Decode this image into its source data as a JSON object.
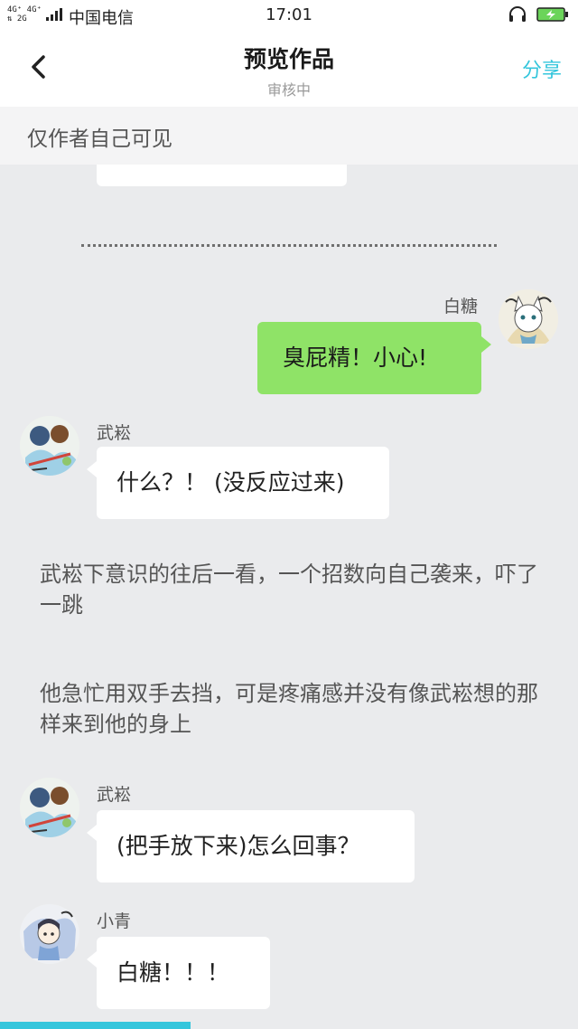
{
  "status_bar": {
    "network": "4G⁺ 4G⁺",
    "network_2": "⇅ 2G",
    "carrier": "中国电信",
    "time": "17:01",
    "icons": [
      "signal-bars-icon",
      "headset-icon",
      "battery-charging-icon"
    ]
  },
  "nav": {
    "back_icon": "chevron-left-icon",
    "title": "预览作品",
    "subtitle": "审核中",
    "share_label": "分享"
  },
  "notice": {
    "text": "仅作者自己可见"
  },
  "messages": [
    {
      "speaker": "白糖",
      "side": "right",
      "text": "臭屁精！小心!"
    },
    {
      "speaker": "武崧",
      "side": "left",
      "text": "什么？！ (没反应过来)"
    },
    {
      "type": "narration",
      "text": "武崧下意识的往后一看，一个招数向自己袭来，吓了一跳"
    },
    {
      "type": "narration",
      "text": "他急忙用双手去挡，可是疼痛感并没有像武崧想的那样来到他的身上"
    },
    {
      "speaker": "武崧",
      "side": "left",
      "text": "(把手放下来)怎么回事？"
    },
    {
      "speaker": "小青",
      "side": "left",
      "text": "白糖！！！"
    }
  ],
  "reading_progress": 0.33,
  "colors": {
    "accent": "#35c6dc",
    "right_bubble": "#8fe367",
    "left_bubble": "#ffffff",
    "background": "#eaebed"
  }
}
